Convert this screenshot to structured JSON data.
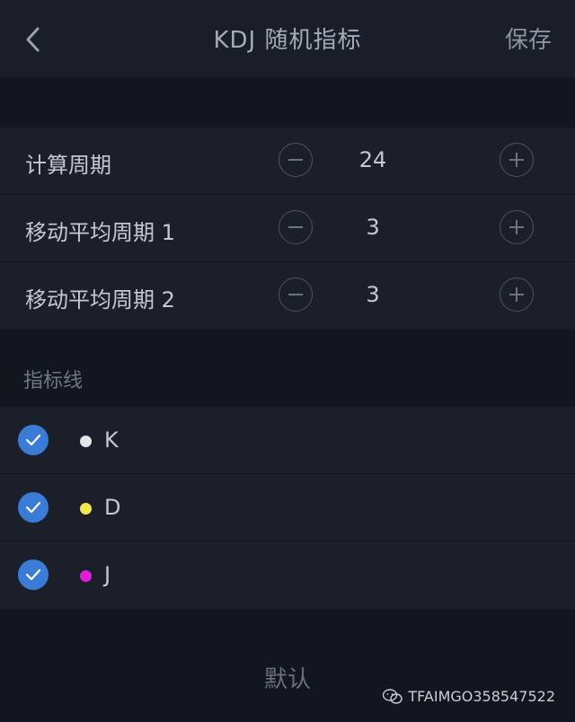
{
  "header": {
    "title": "KDJ 随机指标",
    "save_label": "保存"
  },
  "params": [
    {
      "label": "计算周期",
      "value": "24"
    },
    {
      "label": "移动平均周期 1",
      "value": "3"
    },
    {
      "label": "移动平均周期 2",
      "value": "3"
    }
  ],
  "lines_section": {
    "title": "指标线",
    "items": [
      {
        "name": "K",
        "color": "#e6e6e6",
        "checked": true
      },
      {
        "name": "D",
        "color": "#f2e94e",
        "checked": true
      },
      {
        "name": "J",
        "color": "#e020d8",
        "checked": true
      }
    ]
  },
  "footer": {
    "default_label": "默认",
    "watermark": "TFAIMGO358547522"
  },
  "colors": {
    "accent": "#3a7bd5",
    "background": "#12161f",
    "panel": "#1b1f2a"
  }
}
